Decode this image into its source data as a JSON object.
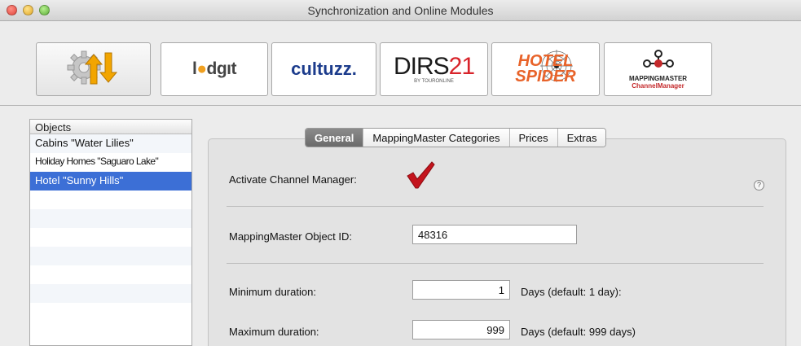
{
  "window": {
    "title": "Synchronization and Online Modules"
  },
  "toolbar": {
    "modules": [
      {
        "name": "sync",
        "icon": "sync-gear-arrows-icon"
      },
      {
        "name": "lodgit",
        "logo_pre": "l",
        "logo_dot": "●",
        "logo_post": "dgıt"
      },
      {
        "name": "cultuzz",
        "logo": "cultuzz."
      },
      {
        "name": "dirs21",
        "logo_a": "DIRS",
        "logo_b": "21",
        "logo_sub": "BY TOURONLINE"
      },
      {
        "name": "hotelspider",
        "logo_line1": "HOTEL",
        "logo_line2": "SPIDER"
      },
      {
        "name": "mappingmaster",
        "logo_line1": "MAPPINGMASTER",
        "logo_line2": "ChannelManager"
      }
    ]
  },
  "objects": {
    "header": "Objects",
    "items": [
      {
        "label": "Cabins \"Water Lilies\"",
        "selected": false
      },
      {
        "label": "Holiday Homes \"Saguaro Lake\"",
        "selected": false
      },
      {
        "label": "Hotel \"Sunny Hills\"",
        "selected": true
      }
    ],
    "empty_rows": 7
  },
  "tabs": [
    {
      "label": "General",
      "active": true
    },
    {
      "label": "MappingMaster Categories",
      "active": false
    },
    {
      "label": "Prices",
      "active": false
    },
    {
      "label": "Extras",
      "active": false
    }
  ],
  "general": {
    "activate_label": "Activate Channel Manager:",
    "activate_checked": true,
    "help_glyph": "?",
    "object_id_label": "MappingMaster Object ID:",
    "object_id_value": "48316",
    "min_label": "Minimum duration:",
    "min_value": "1",
    "min_hint": "Days (default: 1 day):",
    "max_label": "Maximum duration:",
    "max_value": "999",
    "max_hint": "Days (default: 999 days)"
  },
  "colors": {
    "selection": "#3c6fd6",
    "check": "#c4141d",
    "active_tab": "#7b7b7b"
  }
}
